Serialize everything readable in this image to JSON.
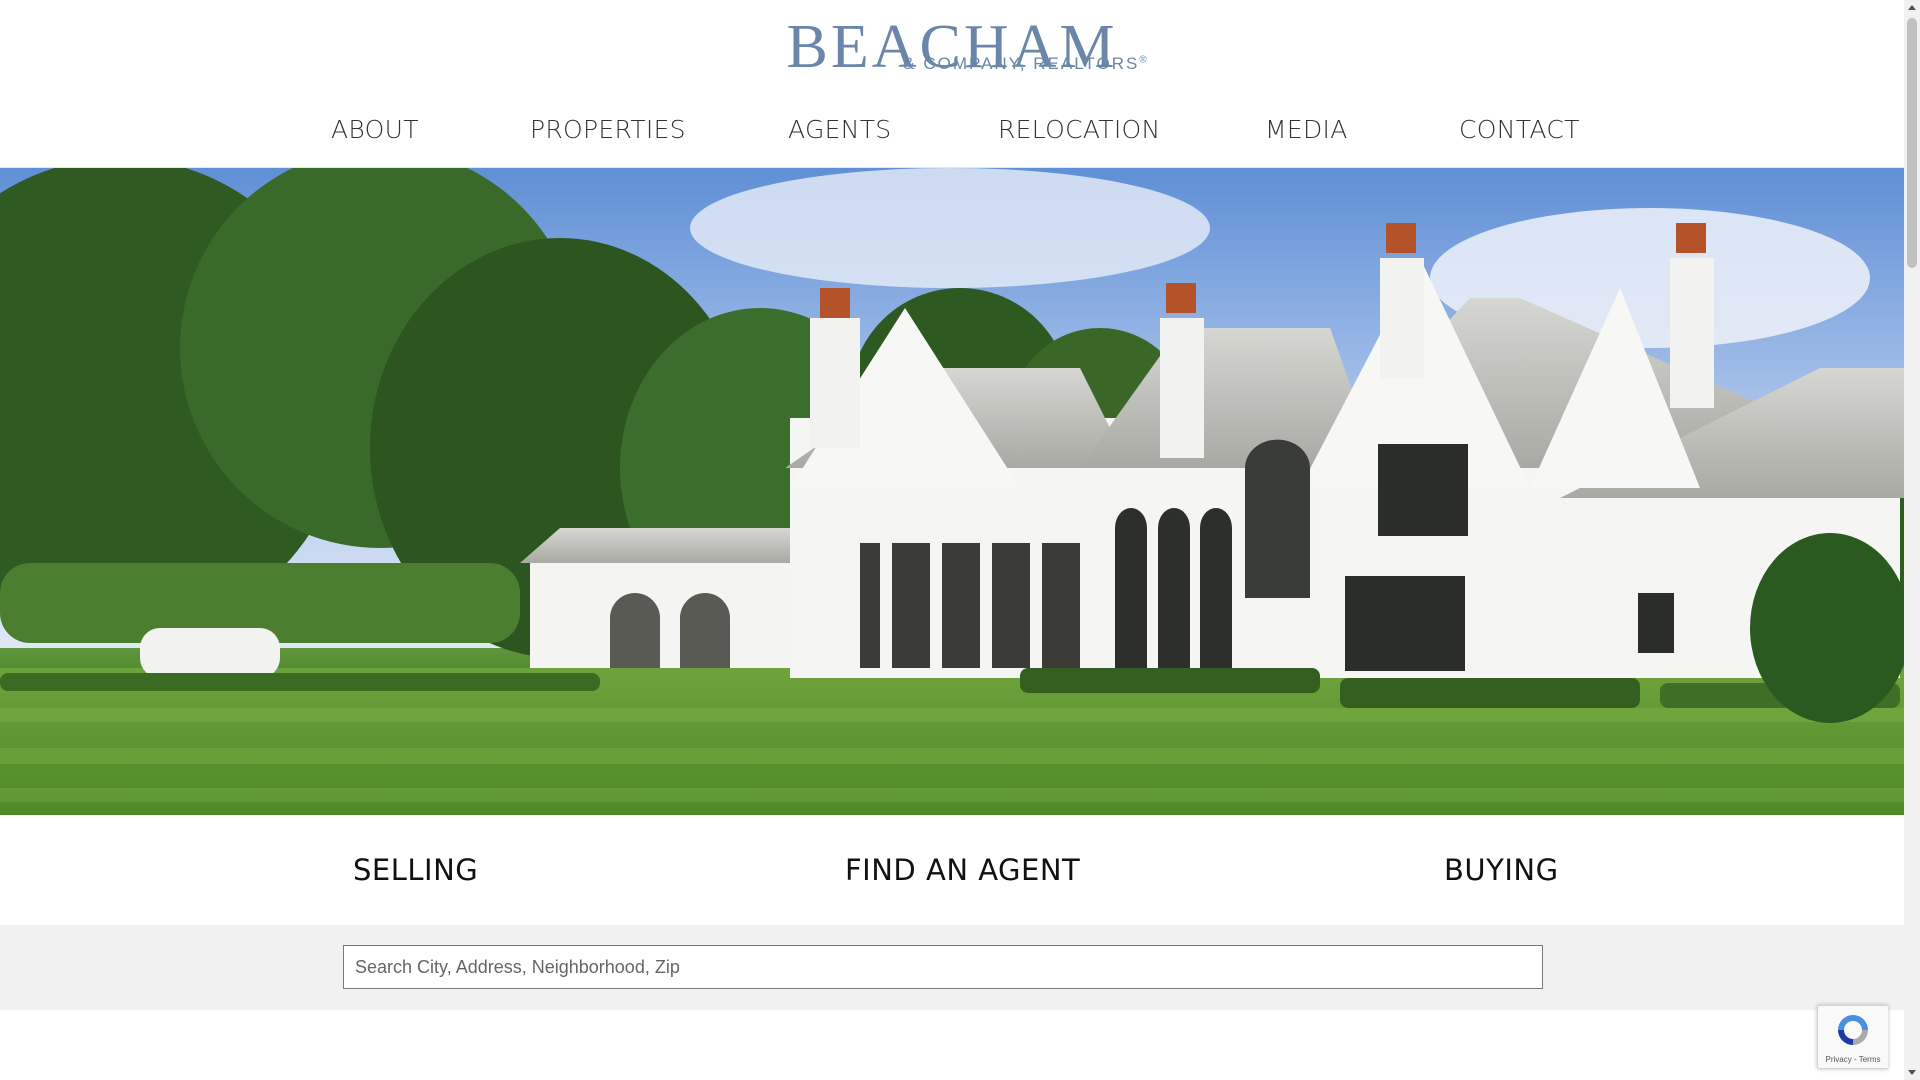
{
  "brand": {
    "name": "BEACHAM",
    "tagline": "& COMPANY, REALTORS",
    "registered": "®",
    "color": "#6a86a8"
  },
  "nav": {
    "items": [
      {
        "label": "ABOUT"
      },
      {
        "label": "PROPERTIES"
      },
      {
        "label": "AGENTS"
      },
      {
        "label": "RELOCATION"
      },
      {
        "label": "MEDIA"
      },
      {
        "label": "CONTACT"
      }
    ]
  },
  "hero": {
    "image": "white-estate-house-photo"
  },
  "quick_links": {
    "selling": "SELLING",
    "find_agent": "FIND AN AGENT",
    "buying": "BUYING"
  },
  "search": {
    "placeholder": "Search City, Address, Neighborhood, Zip",
    "value": ""
  },
  "recaptcha": {
    "text": "Privacy - Terms"
  }
}
